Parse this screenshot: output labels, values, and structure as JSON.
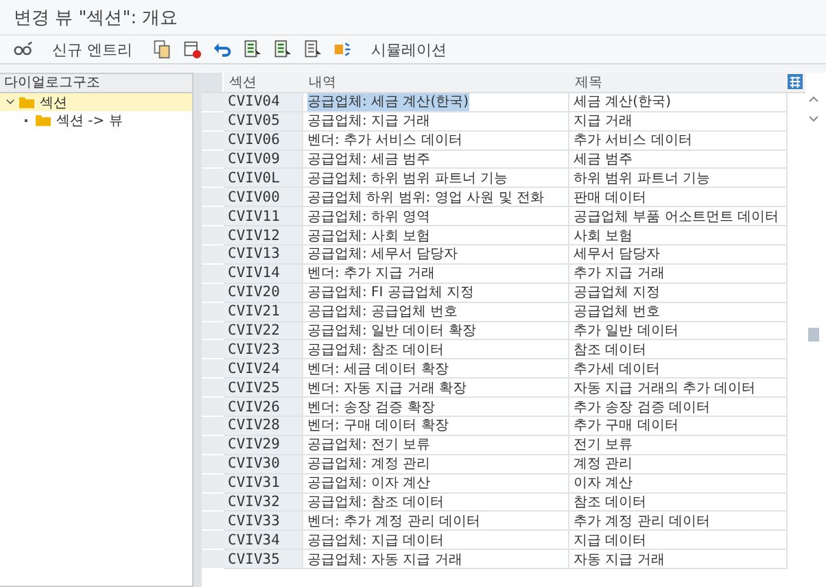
{
  "window": {
    "title": "변경 뷰 \"섹션\": 개요"
  },
  "toolbar": {
    "buttons": [
      {
        "kind": "icon"
      },
      {
        "kind": "text",
        "label": "신규 엔트리"
      },
      {
        "kind": "icon"
      },
      {
        "kind": "icon"
      },
      {
        "kind": "icon"
      },
      {
        "kind": "icon"
      },
      {
        "kind": "icon"
      },
      {
        "kind": "icon"
      },
      {
        "kind": "icon"
      },
      {
        "kind": "text",
        "label": "시뮬레이션"
      }
    ]
  },
  "tree": {
    "title": "다이얼로그구조",
    "items": [
      {
        "label": "섹션",
        "selected": true,
        "expanded": true,
        "children": [
          {
            "label": "섹션 -> 뷰",
            "selected": false
          }
        ]
      }
    ]
  },
  "table": {
    "columns": [
      "섹션",
      "내역",
      "제목"
    ],
    "rows": [
      {
        "section": "CVIV04",
        "description": "공급업체: 세금 계산(한국)",
        "title": "세금 계산(한국)",
        "selected": true
      },
      {
        "section": "CVIV05",
        "description": "공급업체: 지급 거래",
        "title": "지급 거래",
        "selected": false
      },
      {
        "section": "CVIV06",
        "description": "벤더: 추가 서비스 데이터",
        "title": "추가 서비스 데이터",
        "selected": false
      },
      {
        "section": "CVIV09",
        "description": "공급업체: 세금 범주",
        "title": "세금 범주",
        "selected": false
      },
      {
        "section": "CVIV0L",
        "description": "공급업체: 하위 범위 파트너 기능",
        "title": "하위 범위 파트너 기능",
        "selected": false
      },
      {
        "section": "CVIV00",
        "description": "공급업체 하위 범위: 영업 사원 및 전화",
        "title": "판매 데이터",
        "selected": false
      },
      {
        "section": "CVIV11",
        "description": "공급업체: 하위 영역",
        "title": "공급업체 부품 어소트먼트 데이터",
        "selected": false
      },
      {
        "section": "CVIV12",
        "description": "공급업체: 사회 보험",
        "title": "사회 보험",
        "selected": false
      },
      {
        "section": "CVIV13",
        "description": "공급업체: 세무서 담당자",
        "title": "세무서 담당자",
        "selected": false
      },
      {
        "section": "CVIV14",
        "description": "벤더: 추가 지급 거래",
        "title": "추가 지급 거래",
        "selected": false
      },
      {
        "section": "CVIV20",
        "description": "공급업체: FI 공급업체 지정",
        "title": "공급업체 지정",
        "selected": false
      },
      {
        "section": "CVIV21",
        "description": "공급업체: 공급업체 번호",
        "title": "공급업체 번호",
        "selected": false
      },
      {
        "section": "CVIV22",
        "description": "공급업체: 일반 데이터 확장",
        "title": "추가 일반 데이터",
        "selected": false
      },
      {
        "section": "CVIV23",
        "description": "공급업체: 참조 데이터",
        "title": "참조 데이터",
        "selected": false
      },
      {
        "section": "CVIV24",
        "description": "벤더: 세금 데이터 확장",
        "title": "추가세 데이터",
        "selected": false
      },
      {
        "section": "CVIV25",
        "description": "벤더: 자동 지급 거래 확장",
        "title": "자동 지급 거래의 추가 데이터",
        "selected": false
      },
      {
        "section": "CVIV26",
        "description": "벤더: 송장 검증 확장",
        "title": "추가 송장 검증 데이터",
        "selected": false
      },
      {
        "section": "CVIV28",
        "description": "벤더: 구매 데이터 확장",
        "title": "추가 구매 데이터",
        "selected": false
      },
      {
        "section": "CVIV29",
        "description": "공급업체: 전기 보류",
        "title": "전기 보류",
        "selected": false
      },
      {
        "section": "CVIV30",
        "description": "공급업체: 계정 관리",
        "title": "계정 관리",
        "selected": false
      },
      {
        "section": "CVIV31",
        "description": "공급업체: 이자 계산",
        "title": "이자 계산",
        "selected": false
      },
      {
        "section": "CVIV32",
        "description": "공급업체: 참조 데이터",
        "title": "참조 데이터",
        "selected": false
      },
      {
        "section": "CVIV33",
        "description": "벤더: 추가 계정 관리 데이터",
        "title": "추가 계정 관리 데이터",
        "selected": false
      },
      {
        "section": "CVIV34",
        "description": "공급업체: 지급 데이터",
        "title": "지급 데이터",
        "selected": false
      },
      {
        "section": "CVIV35",
        "description": "공급업체: 자동 지급 거래",
        "title": "자동 지급 거래",
        "selected": false
      }
    ]
  }
}
